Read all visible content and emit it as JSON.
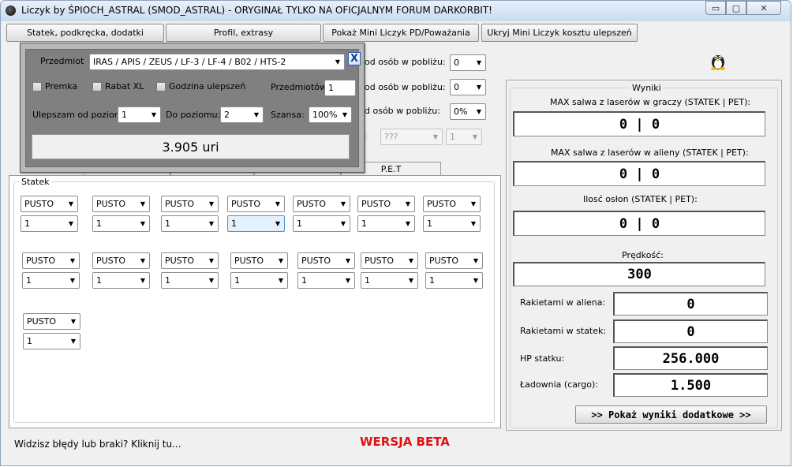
{
  "window": {
    "title": "Liczyk by ŚPIOCH_ASTRAL (SMOD_ASTRAL) - ORYGINAŁ TYLKO NA OFICJALNYM FORUM DARKORBIT!",
    "minimize": "▭",
    "maximize": "▢",
    "close": "✕"
  },
  "toolbar": {
    "btn1": "Statek, podkręcka, dodatki",
    "btn2": "Profil, extrasy",
    "btn3": "Pokaż Mini Liczyk PD/Poważania",
    "btn4": "Ukryj Mini Liczyk kosztu ulepszeń"
  },
  "behind": {
    "row1_label": "od osób w pobliżu:",
    "row1_value": "0",
    "row2_label": "od osób w pobliżu:",
    "row2_value": "0",
    "row3_label": "d osób w pobliżu:",
    "row3_value": "0%",
    "row4_label": ":",
    "row4_value1": "???",
    "row4_value2": "1"
  },
  "popup": {
    "item_label": "Przedmiot",
    "item_value": "IRAS / APIS / ZEUS / LF-3 / LF-4 / B02 / HTS-2",
    "close": "X",
    "premka": "Premka",
    "rabat": "Rabat XL",
    "godzina": "Godzina ulepszeń",
    "count_label": "Przedmiotów:",
    "count_value": "1",
    "from_label": "Ulepszam od poziomu:",
    "from_value": "1",
    "to_label": "Do poziomu:",
    "to_value": "2",
    "chance_label": "Szansa:",
    "chance_value": "100%",
    "result": "3.905 uri"
  },
  "tabs": {
    "pet": "P.E.T"
  },
  "ship": {
    "group_title": "Statek",
    "slot_empty": "PUSTO",
    "level_default": "1"
  },
  "results": {
    "group_title": "Wyniki",
    "max_players_label": "MAX salwa z laserów w graczy (STATEK | PET):",
    "max_players_value": "0 | 0",
    "max_aliens_label": "MAX salwa z laserów w alieny (STATEK | PET):",
    "max_aliens_value": "0 | 0",
    "shields_label": "Ilosć osłon (STATEK | PET):",
    "shields_value": "0 | 0",
    "speed_label": "Prędkość:",
    "speed_value": "300",
    "rockets_alien_label": "Rakietami w aliena:",
    "rockets_alien_value": "0",
    "rockets_ship_label": "Rakietami w statek:",
    "rockets_ship_value": "0",
    "hp_label": "HP statku:",
    "hp_value": "256.000",
    "cargo_label": "Ładownia (cargo):",
    "cargo_value": "1.500",
    "more_button": ">> Pokaż wyniki dodatkowe >>"
  },
  "footer": {
    "bug_link": "Widzisz błędy lub braki? Kliknij tu...",
    "beta": "WERSJA BETA"
  },
  "colors": {
    "beta": "#e01010"
  }
}
